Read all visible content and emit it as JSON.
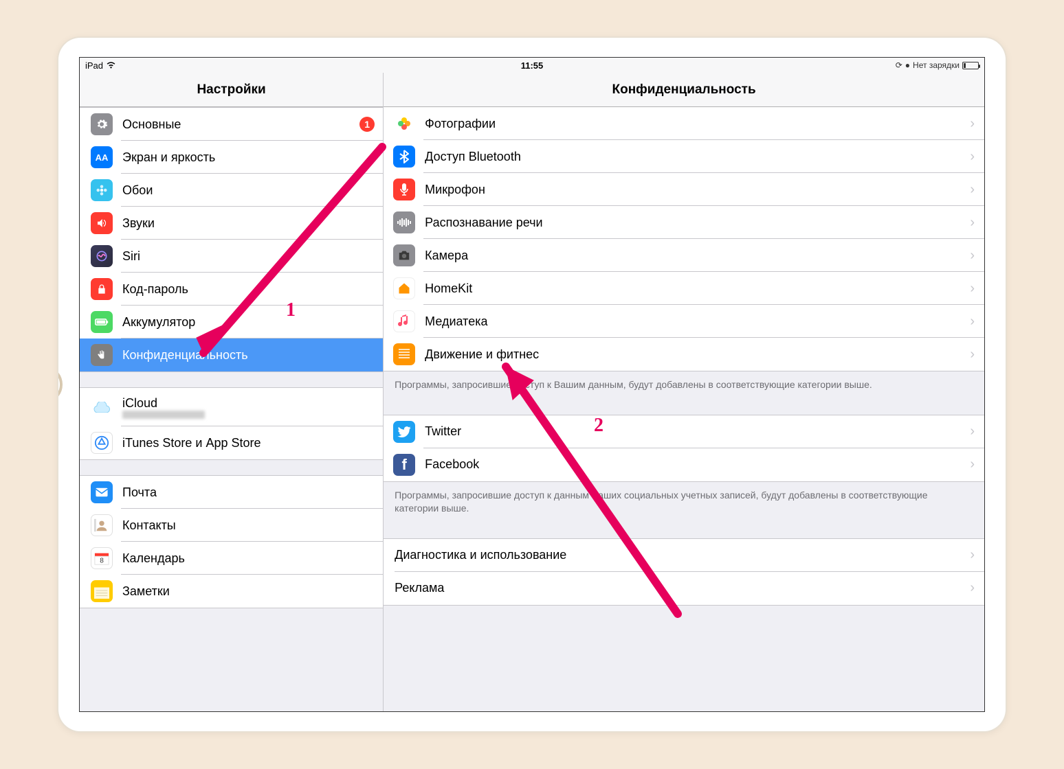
{
  "statusbar": {
    "device": "iPad",
    "time": "11:55",
    "battery_text": "Нет зарядки"
  },
  "sidebar": {
    "title": "Настройки",
    "groups": [
      {
        "items": [
          {
            "key": "general",
            "label": "Основные",
            "badge": "1"
          },
          {
            "key": "display",
            "label": "Экран и яркость"
          },
          {
            "key": "wallpaper",
            "label": "Обои"
          },
          {
            "key": "sounds",
            "label": "Звуки"
          },
          {
            "key": "siri",
            "label": "Siri"
          },
          {
            "key": "passcode",
            "label": "Код-пароль"
          },
          {
            "key": "battery",
            "label": "Аккумулятор"
          },
          {
            "key": "privacy",
            "label": "Конфиденциальность",
            "selected": true
          }
        ]
      },
      {
        "items": [
          {
            "key": "icloud",
            "label": "iCloud",
            "sub_blurred": true
          },
          {
            "key": "itunes",
            "label": "iTunes Store и App Store"
          }
        ]
      },
      {
        "items": [
          {
            "key": "mail",
            "label": "Почта"
          },
          {
            "key": "contacts",
            "label": "Контакты"
          },
          {
            "key": "calendar",
            "label": "Календарь"
          },
          {
            "key": "notes",
            "label": "Заметки"
          }
        ]
      }
    ]
  },
  "detail": {
    "title": "Конфиденциальность",
    "group1": [
      {
        "key": "photos",
        "label": "Фотографии"
      },
      {
        "key": "bluetooth",
        "label": "Доступ Bluetooth"
      },
      {
        "key": "mic",
        "label": "Микрофон"
      },
      {
        "key": "speech",
        "label": "Распознавание речи"
      },
      {
        "key": "camera",
        "label": "Камера"
      },
      {
        "key": "homekit",
        "label": "HomeKit"
      },
      {
        "key": "media",
        "label": "Медиатека"
      },
      {
        "key": "motion",
        "label": "Движение и фитнес"
      }
    ],
    "footer1": "Программы, запросившие доступ к Вашим данным, будут добавлены в соответствующие категории выше.",
    "group2": [
      {
        "key": "twitter",
        "label": "Twitter"
      },
      {
        "key": "facebook",
        "label": "Facebook"
      }
    ],
    "footer2": "Программы, запросившие доступ к данным Ваших социальных учетных записей, будут добавлены в соответствующие категории выше.",
    "group3": [
      {
        "key": "diag",
        "label": "Диагностика и использование"
      },
      {
        "key": "ads",
        "label": "Реклама"
      }
    ]
  },
  "annotations": {
    "a1": "1",
    "a2": "2"
  }
}
